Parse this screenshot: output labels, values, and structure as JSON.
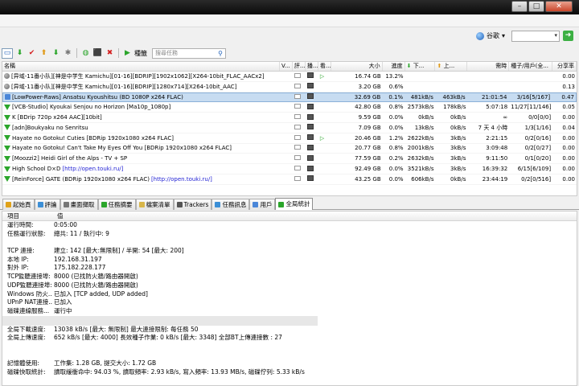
{
  "window": {
    "minimize": "–",
    "maximize": "□",
    "close": "✕"
  },
  "topbar": {
    "search_engine_label": "谷歌",
    "search_engine_arrow": "▾",
    "search_placeholder": "",
    "go": "➜"
  },
  "toolbar": {
    "rss_label": "種籤",
    "filter_placeholder": "搜尋任務"
  },
  "columns": [
    "名稱",
    "V...",
    "評...",
    "播...",
    "看...",
    "大小",
    "進度",
    "下...",
    "上...",
    "需時",
    "種子/用戶(全...",
    "分享率"
  ],
  "torrents": [
    {
      "status": "gray",
      "name": "[异域-11番小队][神是中学生 Kamichu][01-16][BDRIP][1902x1062][X264-10bit_FLAC_AACx2]",
      "url": "",
      "has_play": true,
      "size": "16.74 GB",
      "progress": "13.2%",
      "down": "",
      "up": "",
      "eta": "",
      "peers": "",
      "ratio": "0.00"
    },
    {
      "status": "gray",
      "name": "[异域-11番小队][神是中学生 Kamichu][01-16][BDRIP][1280x714][X264-10bit_AAC]",
      "url": "",
      "has_play": false,
      "size": "3.20 GB",
      "progress": "0.6%",
      "down": "",
      "up": "",
      "eta": "",
      "peers": "",
      "ratio": "0.13"
    },
    {
      "status": "pause",
      "name": "[LowPower-Raws] Ansatsu Kyoushitsu (BD 1080P x264 FLAC)",
      "url": "",
      "has_play": false,
      "size": "32.69 GB",
      "progress": "0.1%",
      "down": "481kB/s",
      "up": "463kB/s",
      "eta": "21:01:54",
      "peers": "3/16[5/167]",
      "ratio": "0.47"
    },
    {
      "status": "green",
      "name": "[VCB-Studio] Kyoukai Senjou no Horizon [Ma10p_1080p]",
      "url": "",
      "has_play": false,
      "size": "42.80 GB",
      "progress": "0.8%",
      "down": "2573kB/s",
      "up": "178kB/s",
      "eta": "5:07:18",
      "peers": "11/27[11/146]",
      "ratio": "0.05"
    },
    {
      "status": "green",
      "name": "K [BDrip 720p x264 AAC][10bit]",
      "url": "",
      "has_play": false,
      "size": "9.59 GB",
      "progress": "0.0%",
      "down": "0kB/s",
      "up": "0kB/s",
      "eta": "∞",
      "peers": "0/0[0/0]",
      "ratio": "0.00"
    },
    {
      "status": "green",
      "name": "[adn]Boukyaku no Senritsu",
      "url": "",
      "has_play": false,
      "size": "7.09 GB",
      "progress": "0.0%",
      "down": "13kB/s",
      "up": "0kB/s",
      "eta": "7 天 4 小時",
      "peers": "1/3[1/16]",
      "ratio": "0.04"
    },
    {
      "status": "green",
      "name": "Hayate no Gotoku! Cuties [BDRip 1920x1080 x264 FLAC]",
      "url": "",
      "has_play": true,
      "size": "20.46 GB",
      "progress": "1.2%",
      "down": "2622kB/s",
      "up": "3kB/s",
      "eta": "2:21:15",
      "peers": "0/2[0/16]",
      "ratio": "0.00"
    },
    {
      "status": "green",
      "name": "Hayate no Gotoku! Can't Take My Eyes Off You [BDRip 1920x1080 x264 FLAC]",
      "url": "",
      "has_play": false,
      "size": "20.77 GB",
      "progress": "0.8%",
      "down": "2001kB/s",
      "up": "3kB/s",
      "eta": "3:09:48",
      "peers": "0/2[0/27]",
      "ratio": "0.00"
    },
    {
      "status": "green",
      "name": "[Moozzi2] Heidi Girl of the Alps - TV + SP",
      "url": "",
      "has_play": false,
      "size": "77.59 GB",
      "progress": "0.2%",
      "down": "2632kB/s",
      "up": "3kB/s",
      "eta": "9:11:50",
      "peers": "0/1[0/20]",
      "ratio": "0.00"
    },
    {
      "status": "green",
      "name": "High School D×D",
      "url": "[http://open.touki.ru/]",
      "has_play": false,
      "size": "92.49 GB",
      "progress": "0.0%",
      "down": "3521kB/s",
      "up": "3kB/s",
      "eta": "16:39:32",
      "peers": "6/15[6/109]",
      "ratio": "0.00"
    },
    {
      "status": "green",
      "name": "[ReinForce] GATE (BDRip 1920x1080 x264 FLAC)",
      "url": "[http://open.touki.ru/]",
      "has_play": false,
      "size": "43.25 GB",
      "progress": "0.0%",
      "down": "606kB/s",
      "up": "0kB/s",
      "eta": "23:44:19",
      "peers": "0/2[0/516]",
      "ratio": "0.00"
    }
  ],
  "tabs": [
    {
      "label": "起始頁",
      "color": "#e0a21a"
    },
    {
      "label": "評論",
      "color": "#3c8fd6"
    },
    {
      "label": "畫面擷取",
      "color": "#777777"
    },
    {
      "label": "任務摘要",
      "color": "#2aa52a"
    },
    {
      "label": "檔案清單",
      "color": "#d8b64a"
    },
    {
      "label": "Trackers",
      "color": "#555555"
    },
    {
      "label": "任務訊息",
      "color": "#3c8fd6"
    },
    {
      "label": "用戶",
      "color": "#4a86d8"
    },
    {
      "label": "全局統計",
      "color": "#2aa52a"
    }
  ],
  "stats": {
    "header_key": "項目",
    "header_value": "值",
    "rows": [
      {
        "k": "運行時間:",
        "v": "0:05:00"
      },
      {
        "k": "任務運行狀態:",
        "v": "總共: 11 / 執行中: 9"
      },
      {
        "gap": true
      },
      {
        "k": "TCP 連接:",
        "v": "建立: 142 [最大:無限制] / 半開: 54 [最大: 200]"
      },
      {
        "k": "本地 IP:",
        "v": "192.168.31.197"
      },
      {
        "k": "對外 IP:",
        "v": "175.182.228.177"
      },
      {
        "k": "TCP監聽連接埠:",
        "v": "8000 (已找防火牆/路由器開啟)"
      },
      {
        "k": "UDP監聽連接埠:",
        "v": "8000 (已找防火牆/路由器開啟)"
      },
      {
        "k": "Windows 防火...",
        "v": "已加入 [TCP added, UDP added]"
      },
      {
        "k": "UPnP NAT連接...",
        "v": "已加入"
      },
      {
        "k": "磁碟連線服務...",
        "v": "運行中"
      },
      {
        "bar": true
      },
      {
        "k": "全局下載速度:",
        "v": "13038 kB/s [最大: 無限制]     最大連接限制: 每任務 50"
      },
      {
        "k": "全局上傳速度:",
        "v": "652 kB/s [最大: 4000]     長效種子作業: 0 kB/s [最大: 3348]     全部BT上傳連接數 : 27"
      },
      {
        "gap": true
      },
      {
        "gap": true
      },
      {
        "k": "記憶體使用:",
        "v": "工作集: 1.28 GB, 提交大小: 1.72 GB"
      },
      {
        "k": "磁碟快取統計:",
        "v": "讀取緩衝命中: 94.03 %, 讀取頻率: 2.93 kB/s, 寫入頻率: 13.93 MB/s, 磁碟佇列: 5.33 kB/s"
      }
    ]
  }
}
